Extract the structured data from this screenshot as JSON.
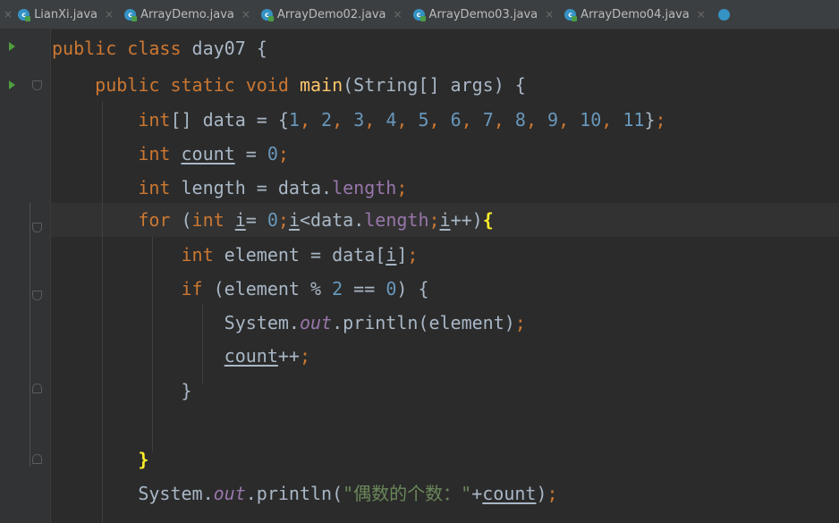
{
  "tabs": [
    {
      "label": "LianXi.java"
    },
    {
      "label": "ArrayDemo.java"
    },
    {
      "label": "ArrayDemo02.java"
    },
    {
      "label": "ArrayDemo03.java"
    },
    {
      "label": "ArrayDemo04.java"
    }
  ],
  "tab_icon_glyph": "c",
  "close_glyph": "×",
  "code": {
    "l1": {
      "kw1": "public class ",
      "rest": "day07 {"
    },
    "l2": {
      "kw1": "public static void ",
      "name": "main",
      "rest": "(String[] args) {"
    },
    "l3": {
      "t": "int",
      "a": "[] data = {",
      "n": [
        "1",
        "2",
        "3",
        "4",
        "5",
        "6",
        "7",
        "8",
        "9",
        "10",
        "11"
      ],
      "sep": ", ",
      "close": "}",
      "semi": ";"
    },
    "l4": {
      "t": "int ",
      "v": "count",
      "a": " = ",
      "n": "0",
      "semi": ";"
    },
    "l5": {
      "t": "int ",
      "v": "length",
      "a": " = data.",
      "f": "length",
      "semi": ";"
    },
    "l6": {
      "kw": "for",
      "a": " (",
      "t": "int ",
      "i1": "i",
      "b": "= ",
      "n": "0",
      "s1": ";",
      "i2": "i",
      "c": "<data.",
      "f": "length",
      "s2": ";",
      "i3": "i",
      "d": "++)",
      "brace": "{"
    },
    "l7": {
      "t": "int ",
      "a": "element = data[",
      "i": "i",
      "b": "]",
      "semi": ";"
    },
    "l8": {
      "kw": "if",
      "a": " (element % ",
      "n1": "2",
      "b": " == ",
      "n2": "0",
      "c": ") {"
    },
    "l9": {
      "a": "System.",
      "o": "out",
      "b": ".println(element)",
      "semi": ";"
    },
    "l10": {
      "v": "count",
      "a": "++",
      "semi": ";"
    },
    "l11": {
      "a": "}"
    },
    "l13": {
      "brace": "}"
    },
    "l14": {
      "a": "System.",
      "o": "out",
      "b": ".println(",
      "s": "\"偶数的个数：\"",
      "c": "+",
      "v": "count",
      "d": ")",
      "semi": ";"
    }
  },
  "colors": {
    "background": "#2b2b2b",
    "keyword": "#cc7832",
    "number": "#6897bb",
    "field": "#9876aa",
    "method": "#ffc66d",
    "string": "#6a8759",
    "text": "#a9b7c6",
    "brace_highlight": "#ffef28"
  }
}
